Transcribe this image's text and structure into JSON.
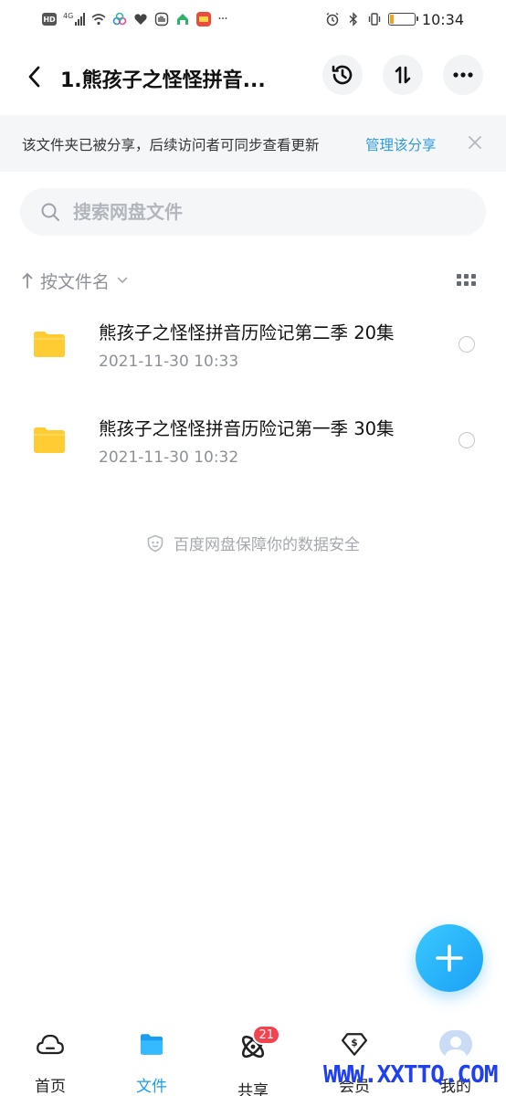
{
  "status_bar": {
    "time": "10:34",
    "network": "4G",
    "hd": "HD",
    "battery_level": 0.15,
    "battery_color": "#f2a51a"
  },
  "header": {
    "title": "1.熊孩子之怪怪拼音...",
    "back_icon": "chevron-left-icon",
    "history_icon": "history-clock-icon",
    "sort_icon": "sort-arrows-icon",
    "more_icon": "more-dots-icon"
  },
  "notice": {
    "text": "该文件夹已被分享，后续访问者可同步查看更新",
    "link": "管理该分享",
    "link_color": "#2f9bd9"
  },
  "search": {
    "placeholder": "搜索网盘文件",
    "value": ""
  },
  "sort": {
    "label": "按文件名"
  },
  "files": [
    {
      "name": "熊孩子之怪怪拼音历险记第二季 20集",
      "date": "2021-11-30  10:33",
      "type": "folder"
    },
    {
      "name": "熊孩子之怪怪拼音历险记第一季 30集",
      "date": "2021-11-30  10:32",
      "type": "folder"
    }
  ],
  "safety_text": "百度网盘保障你的数据安全",
  "bottom_nav": {
    "items": [
      {
        "label": "首页",
        "icon": "home-cloud-icon",
        "active": false
      },
      {
        "label": "文件",
        "icon": "folder-icon",
        "active": true
      },
      {
        "label": "共享",
        "icon": "share-atom-icon",
        "active": false,
        "badge": "21"
      },
      {
        "label": "会员",
        "icon": "vip-diamond-icon",
        "active": false
      },
      {
        "label": "我的",
        "icon": "avatar-icon",
        "active": false
      }
    ]
  },
  "colors": {
    "accent": "#1a9df0",
    "folder": "#ffcc33",
    "badge": "#f2434f"
  },
  "watermark": "WWW.XXTTQ.COM"
}
